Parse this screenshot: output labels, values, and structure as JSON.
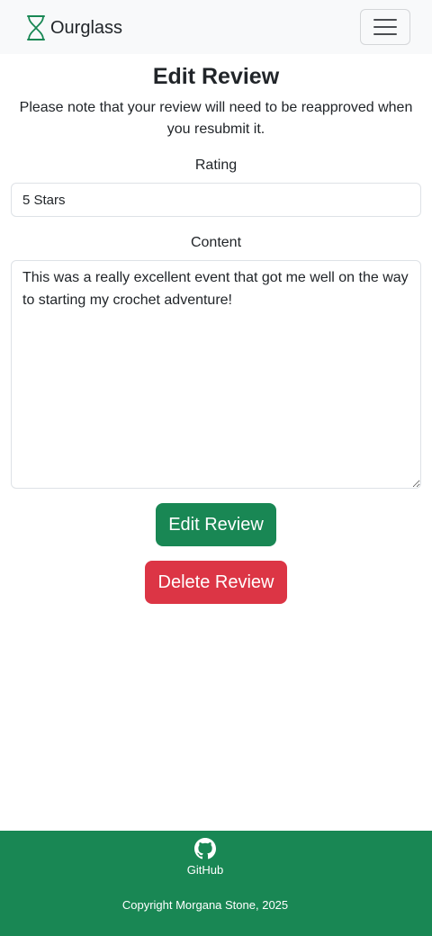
{
  "navbar": {
    "brand_name": "Ourglass",
    "brand_icon": "hourglass-icon",
    "toggler_icon": "hamburger-menu-icon"
  },
  "page": {
    "title": "Edit Review",
    "notice": "Please note that your review will need to be reapproved when you resubmit it."
  },
  "form": {
    "rating_label": "Rating",
    "rating_value": "5 Stars",
    "content_label": "Content",
    "content_value": "This was a really excellent event that got me well on the way to starting my crochet adventure!"
  },
  "buttons": {
    "edit_label": "Edit Review",
    "delete_label": "Delete Review"
  },
  "footer": {
    "github_label": "GitHub",
    "github_icon": "github-icon",
    "copyright": "Copyright Morgana Stone, 2025"
  },
  "colors": {
    "navbar_bg": "#f8f9fa",
    "success": "#198754",
    "danger": "#dc3545",
    "text": "#212529"
  }
}
